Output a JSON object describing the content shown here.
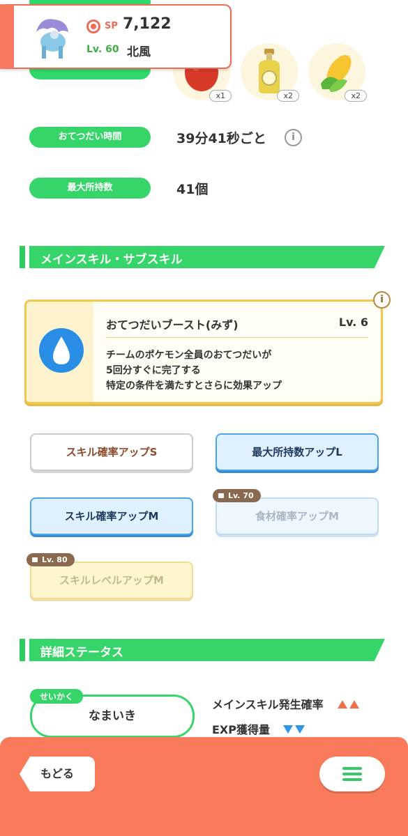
{
  "header": {
    "sp_label": "SP",
    "sp_value": "7,122",
    "level": "Lv. 60",
    "name": "北風"
  },
  "ingredients": [
    {
      "name": "tomato",
      "count": "x1"
    },
    {
      "name": "oil",
      "count": "x2"
    },
    {
      "name": "corn",
      "count": "x2"
    }
  ],
  "stats": [
    {
      "label": "おてつだい時間",
      "value": "39分41秒ごと"
    },
    {
      "label": "最大所持数",
      "value": "41個"
    }
  ],
  "skills_section": {
    "title": "メインスキル・サブスキル"
  },
  "main_skill": {
    "name": "おてつだいブースト(みず)",
    "level": "Lv. 6",
    "desc_line1": "チームのポケモン全員のおてつだいが",
    "desc_line2": "5回分すぐに完了する",
    "desc_line3": "特定の条件を満たすとさらに効果アップ",
    "icon": "water-drop-icon",
    "info_icon": "i"
  },
  "sub_skills": [
    {
      "label": "スキル確率アップS",
      "style": "white"
    },
    {
      "label": "最大所持数アップL",
      "style": "blue"
    },
    {
      "label": "スキル確率アップM",
      "style": "blue"
    },
    {
      "label": "食材確率アップM",
      "style": "blue-locked",
      "lock": "Lv. 70"
    },
    {
      "label": "スキルレベルアップM",
      "style": "gold-locked",
      "lock": "Lv. 80"
    }
  ],
  "details_section": {
    "title": "詳細ステータス"
  },
  "nature": {
    "tag": "せいかく",
    "value": "なまいき",
    "up_effect": "メインスキル発生確率",
    "down_effect": "EXP獲得量"
  },
  "nav": {
    "back": "もどる",
    "info_glyph": "i"
  },
  "colors": {
    "green": "#36d56a",
    "orange": "#f97b5c",
    "blue": "#2e96e6",
    "gold": "#f2c84a"
  }
}
